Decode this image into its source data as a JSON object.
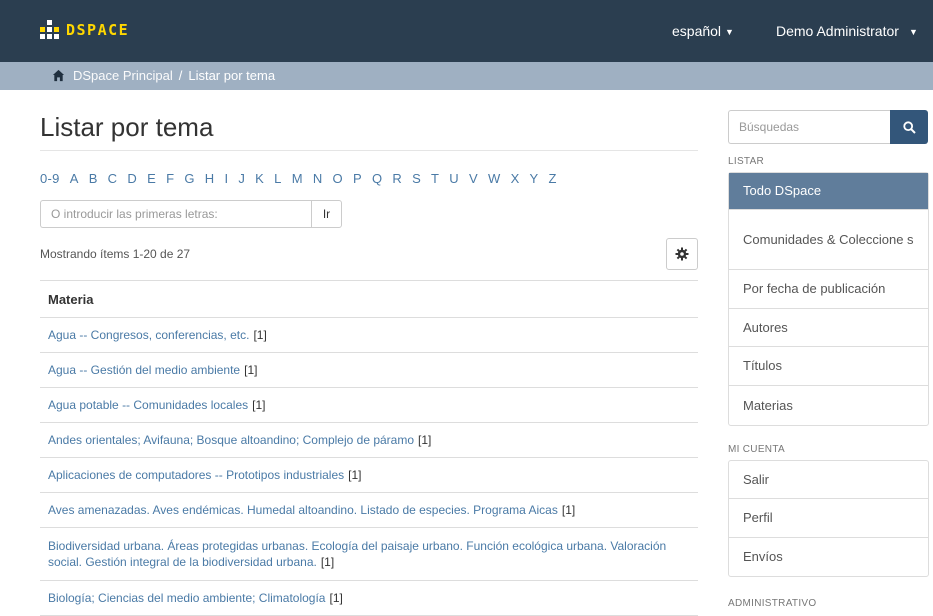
{
  "header": {
    "brand": "DSPACE",
    "language_label": "español",
    "user_label": "Demo Administrator"
  },
  "breadcrumb": {
    "home_label": "DSpace Principal",
    "separator": "/",
    "current_label": "Listar por tema"
  },
  "main": {
    "title": "Listar por tema",
    "letters": [
      "0-9",
      "A",
      "B",
      "C",
      "D",
      "E",
      "F",
      "G",
      "H",
      "I",
      "J",
      "K",
      "L",
      "M",
      "N",
      "O",
      "P",
      "Q",
      "R",
      "S",
      "T",
      "U",
      "V",
      "W",
      "X",
      "Y",
      "Z"
    ],
    "letter_input_placeholder": "O introducir las primeras letras:",
    "go_label": "Ir",
    "showing_text": "Mostrando ítems 1-20 de 27",
    "table_header": "Materia",
    "rows": [
      {
        "text": "Agua -- Congresos, conferencias, etc.",
        "count": "[1]"
      },
      {
        "text": "Agua -- Gestión del medio ambiente",
        "count": "[1]"
      },
      {
        "text": "Agua potable -- Comunidades locales",
        "count": "[1]"
      },
      {
        "text": "Andes orientales; Avifauna; Bosque altoandino; Complejo de páramo",
        "count": "[1]"
      },
      {
        "text": "Aplicaciones de computadores -- Prototipos industriales",
        "count": "[1]"
      },
      {
        "text": "Aves amenazadas. Aves endémicas. Humedal altoandino. Listado de especies. Programa Aicas",
        "count": "[1]"
      },
      {
        "text": "Biodiversidad urbana. Áreas protegidas urbanas. Ecología del paisaje urbano. Función ecológica urbana. Valoración social. Gestión integral de la biodiversidad urbana.",
        "count": "[1]"
      },
      {
        "text": "Biología; Ciencias del medio ambiente; Climatología",
        "count": "[1]"
      }
    ]
  },
  "sidebar": {
    "search_placeholder": "Búsquedas",
    "listar_heading": "LISTAR",
    "listar_items": [
      "Todo DSpace",
      "Comunidades & Coleccione s",
      "Por fecha de publicación",
      "Autores",
      "Títulos",
      "Materias"
    ],
    "cuenta_heading": "MI CUENTA",
    "cuenta_items": [
      "Salir",
      "Perfil",
      "Envíos"
    ],
    "admin_heading": "ADMINISTRATIVO"
  },
  "colors": {
    "topbar": "#2b3e50",
    "crumbbar": "#9fb0c2",
    "active_menu": "#607d9b",
    "search_button": "#33567a",
    "brand_text": "#ffd700"
  }
}
